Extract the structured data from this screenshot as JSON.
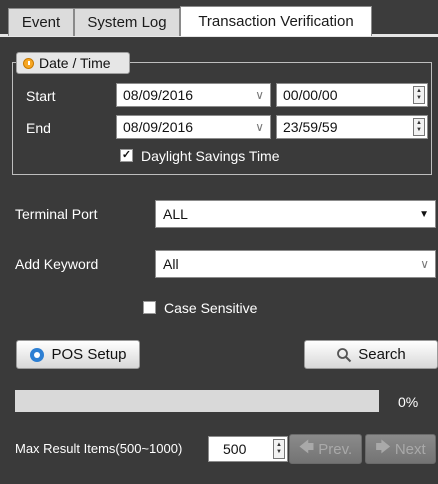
{
  "tabs": [
    {
      "label": "Event",
      "active": false
    },
    {
      "label": "System Log",
      "active": false
    },
    {
      "label": "Transaction Verification",
      "active": true
    }
  ],
  "datetime": {
    "legend": "Date / Time",
    "start_label": "Start",
    "start_date": "08/09/2016",
    "start_time": "00/00/00",
    "end_label": "End",
    "end_date": "08/09/2016",
    "end_time": "23/59/59",
    "dst_label": "Daylight Savings Time",
    "dst_checked": true
  },
  "terminal_port": {
    "label": "Terminal Port",
    "value": "ALL"
  },
  "keyword": {
    "label": "Add Keyword",
    "value": "All"
  },
  "case_sensitive": {
    "label": "Case Sensitive",
    "checked": false
  },
  "buttons": {
    "pos_setup": "POS Setup",
    "search": "Search",
    "prev": "Prev.",
    "next": "Next"
  },
  "progress": {
    "percent_text": "0%",
    "value": 0
  },
  "max_result": {
    "label": "Max Result Items(500~1000)",
    "value": "500"
  },
  "colors": {
    "background": "#3a3a3a",
    "accent": "#f6a623"
  }
}
